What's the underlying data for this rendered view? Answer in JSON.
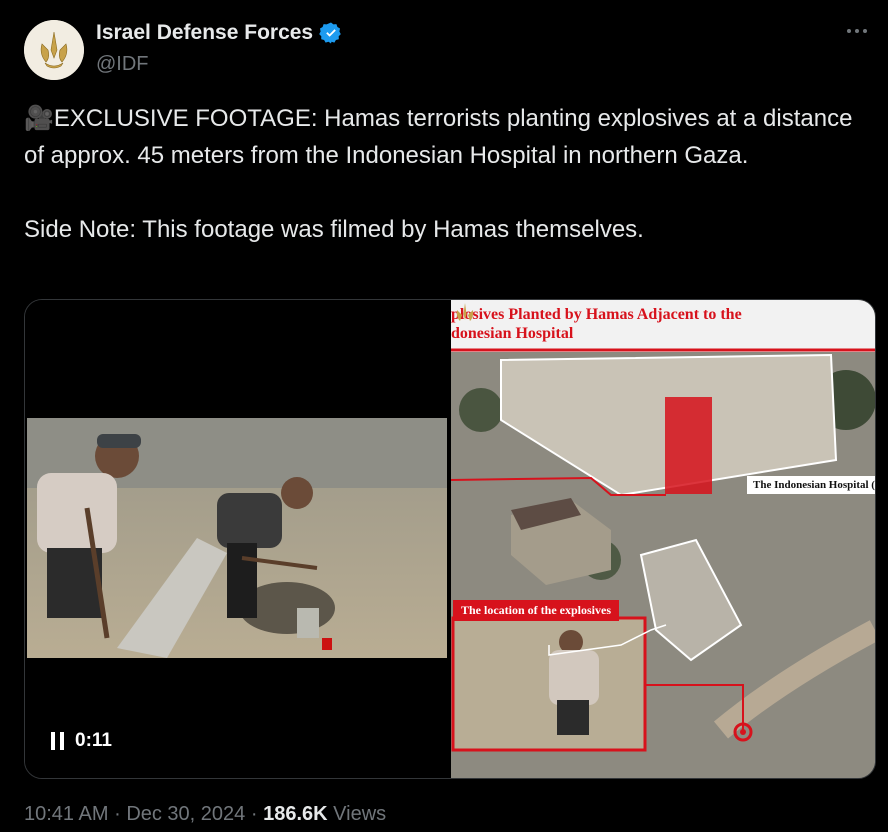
{
  "author": {
    "name": "Israel Defense Forces",
    "handle": "@IDF",
    "verified": true,
    "avatar_icon": "idf-emblem-icon"
  },
  "tweet": {
    "line1": "🎥EXCLUSIVE FOOTAGE: Hamas terrorists planting explosives at a distance of approx. 45 meters from the Indonesian Hospital in northern Gaza.",
    "line2": "Side Note: This footage was filmed by Hamas themselves."
  },
  "media": {
    "video": {
      "time": "0:11",
      "state_icon": "pause-icon"
    },
    "photo": {
      "title": "plosives Planted by Hamas Adjacent to the\ndonesian Hospital",
      "hospital_label": "The Indonesian Hospital (",
      "location_label": "The location of the explosives"
    }
  },
  "meta": {
    "time": "10:41 AM",
    "sep1": "·",
    "date": "Dec 30, 2024",
    "sep2": "·",
    "views_count": "186.6K",
    "views_label": "Views"
  },
  "colors": {
    "accent_red": "#d7121c",
    "verified_blue": "#1d9bf0",
    "muted": "#71767b"
  }
}
